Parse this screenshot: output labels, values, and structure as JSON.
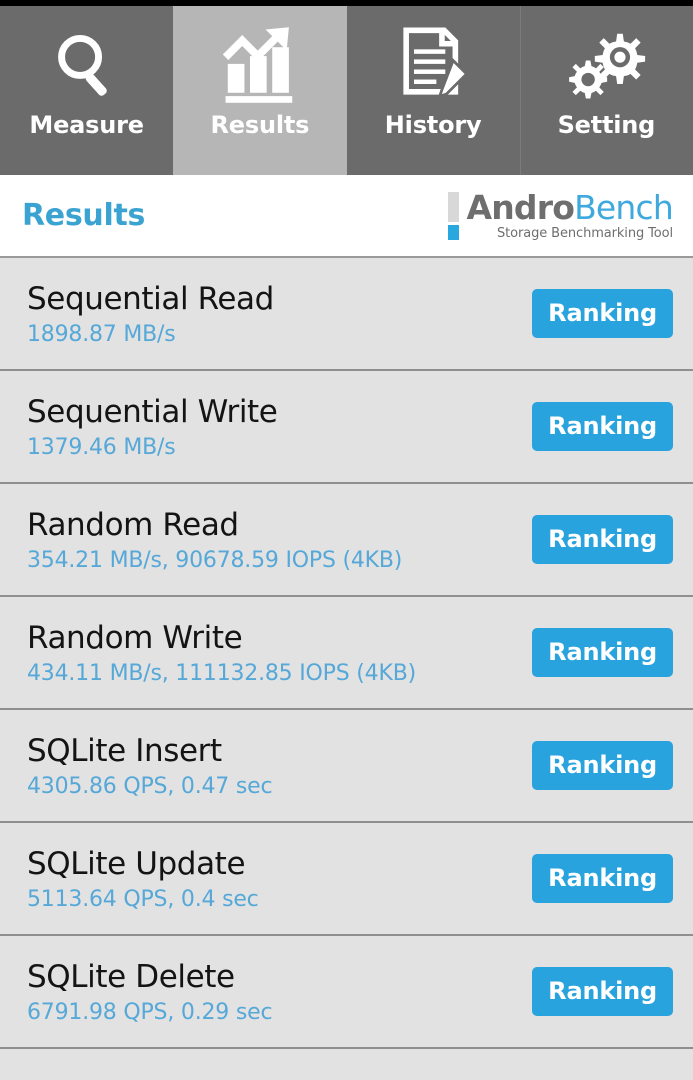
{
  "window": {
    "app_title": "AndroBench"
  },
  "tabbar": {
    "tabs": [
      {
        "label": "Measure",
        "icon": "magnifier-icon",
        "active": false
      },
      {
        "label": "Results",
        "icon": "bar-chart-trend-icon",
        "active": true
      },
      {
        "label": "History",
        "icon": "document-pencil-icon",
        "active": false
      },
      {
        "label": "Setting",
        "icon": "gears-icon",
        "active": false
      }
    ]
  },
  "header": {
    "title": "Results",
    "logo": {
      "name_part1": "Andro",
      "name_part2": "Bench",
      "tagline": "Storage Benchmarking Tool"
    }
  },
  "results": {
    "ranking_label": "Ranking",
    "rows": [
      {
        "title": "Sequential Read",
        "value": "1898.87 MB/s"
      },
      {
        "title": "Sequential Write",
        "value": "1379.46 MB/s"
      },
      {
        "title": "Random Read",
        "value": "354.21 MB/s, 90678.59 IOPS (4KB)"
      },
      {
        "title": "Random Write",
        "value": "434.11 MB/s, 111132.85 IOPS (4KB)"
      },
      {
        "title": "SQLite Insert",
        "value": "4305.86 QPS, 0.47 sec"
      },
      {
        "title": "SQLite Update",
        "value": "5113.64 QPS, 0.4 sec"
      },
      {
        "title": "SQLite Delete",
        "value": "6791.98 QPS, 0.29 sec"
      }
    ]
  },
  "colors": {
    "accent_blue": "#29a3de",
    "value_blue": "#55a8d8",
    "title_blue": "#3ba3d1",
    "tab_inactive": "#6b6b6b",
    "tab_active": "#b6b6b6",
    "list_bg": "#e2e2e2"
  }
}
